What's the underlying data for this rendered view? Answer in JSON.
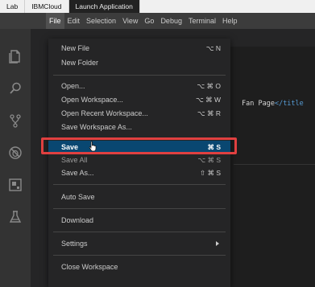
{
  "browser_tabs": [
    "Lab",
    "IBMCloud",
    "Launch Application"
  ],
  "menubar": [
    "File",
    "Edit",
    "Selection",
    "View",
    "Go",
    "Debug",
    "Terminal",
    "Help"
  ],
  "activity_icons": [
    "files-icon",
    "search-icon",
    "source-control-icon",
    "debug-icon",
    "extensions-icon",
    "test-flask-icon"
  ],
  "editor": {
    "code_text": "Fan Page",
    "code_tag": "</title"
  },
  "file_menu": {
    "new_file": {
      "label": "New File",
      "shortcut": "⌥ N"
    },
    "new_folder": {
      "label": "New Folder"
    },
    "open": {
      "label": "Open...",
      "shortcut": "⌥ ⌘ O"
    },
    "open_workspace": {
      "label": "Open Workspace...",
      "shortcut": "⌥ ⌘ W"
    },
    "open_recent": {
      "label": "Open Recent Workspace...",
      "shortcut": "⌥ ⌘ R"
    },
    "save_workspace_as": {
      "label": "Save Workspace As..."
    },
    "save": {
      "label": "Save",
      "shortcut": "⌘ S"
    },
    "save_all": {
      "label": "Save All",
      "shortcut": "⌥ ⌘ S"
    },
    "save_as": {
      "label": "Save As...",
      "shortcut": "⇧ ⌘ S"
    },
    "auto_save": {
      "label": "Auto Save"
    },
    "download": {
      "label": "Download"
    },
    "settings": {
      "label": "Settings"
    },
    "close_workspace": {
      "label": "Close Workspace"
    }
  },
  "colors": {
    "selection": "#094771",
    "highlight_box": "#e04040",
    "menubar": "#3c3c3c",
    "menu_bg": "#252526"
  }
}
